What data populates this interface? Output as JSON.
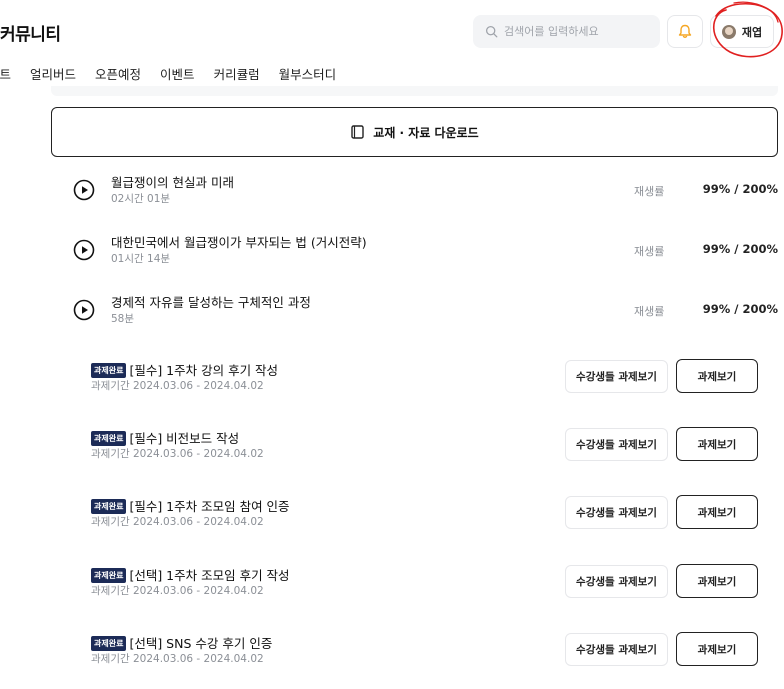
{
  "header": {
    "brand": "커뮤니티",
    "search_placeholder": "검색어를 입력하세요",
    "profile_name": "재엽"
  },
  "nav": {
    "tabs": [
      "스트",
      "얼리버드",
      "오픈예정",
      "이벤트",
      "커리큘럼",
      "월부스터디"
    ]
  },
  "download": {
    "label": "교재 · 자료 다운로드"
  },
  "lectures": [
    {
      "title": "월급쟁이의 현실과 미래",
      "duration": "02시간 01분",
      "rate_label": "재생률",
      "rate": "99% / 200%"
    },
    {
      "title": "대한민국에서 월급쟁이가 부자되는 법 (거시전략)",
      "duration": "01시간 14분",
      "rate_label": "재생률",
      "rate": "99% / 200%"
    },
    {
      "title": "경제적 자유를 달성하는 구체적인 과정",
      "duration": "58분",
      "rate_label": "재생률",
      "rate": "99% / 200%"
    }
  ],
  "tasks": [
    {
      "badge": "과제완료",
      "title": "[필수] 1주차 강의 후기 작성",
      "period": "과제기간 2024.03.06 - 2024.04.02",
      "peer_label": "수강생들 과제보기",
      "view_label": "과제보기"
    },
    {
      "badge": "과제완료",
      "title": "[필수] 비전보드 작성",
      "period": "과제기간 2024.03.06 - 2024.04.02",
      "peer_label": "수강생들 과제보기",
      "view_label": "과제보기"
    },
    {
      "badge": "과제완료",
      "title": "[필수] 1주차 조모임 참여 인증",
      "period": "과제기간 2024.03.06 - 2024.04.02",
      "peer_label": "수강생들 과제보기",
      "view_label": "과제보기"
    },
    {
      "badge": "과제완료",
      "title": "[선택] 1주차 조모임 후기 작성",
      "period": "과제기간 2024.03.06 - 2024.04.02",
      "peer_label": "수강생들 과제보기",
      "view_label": "과제보기"
    },
    {
      "badge": "과제완료",
      "title": "[선택] SNS 수강 후기 인증",
      "period": "과제기간 2024.03.06 - 2024.04.02",
      "peer_label": "수강생들 과제보기",
      "view_label": "과제보기"
    }
  ],
  "colors": {
    "badge_bg": "#1c2b57",
    "bell": "#f5a623",
    "annotation": "#e02020"
  }
}
